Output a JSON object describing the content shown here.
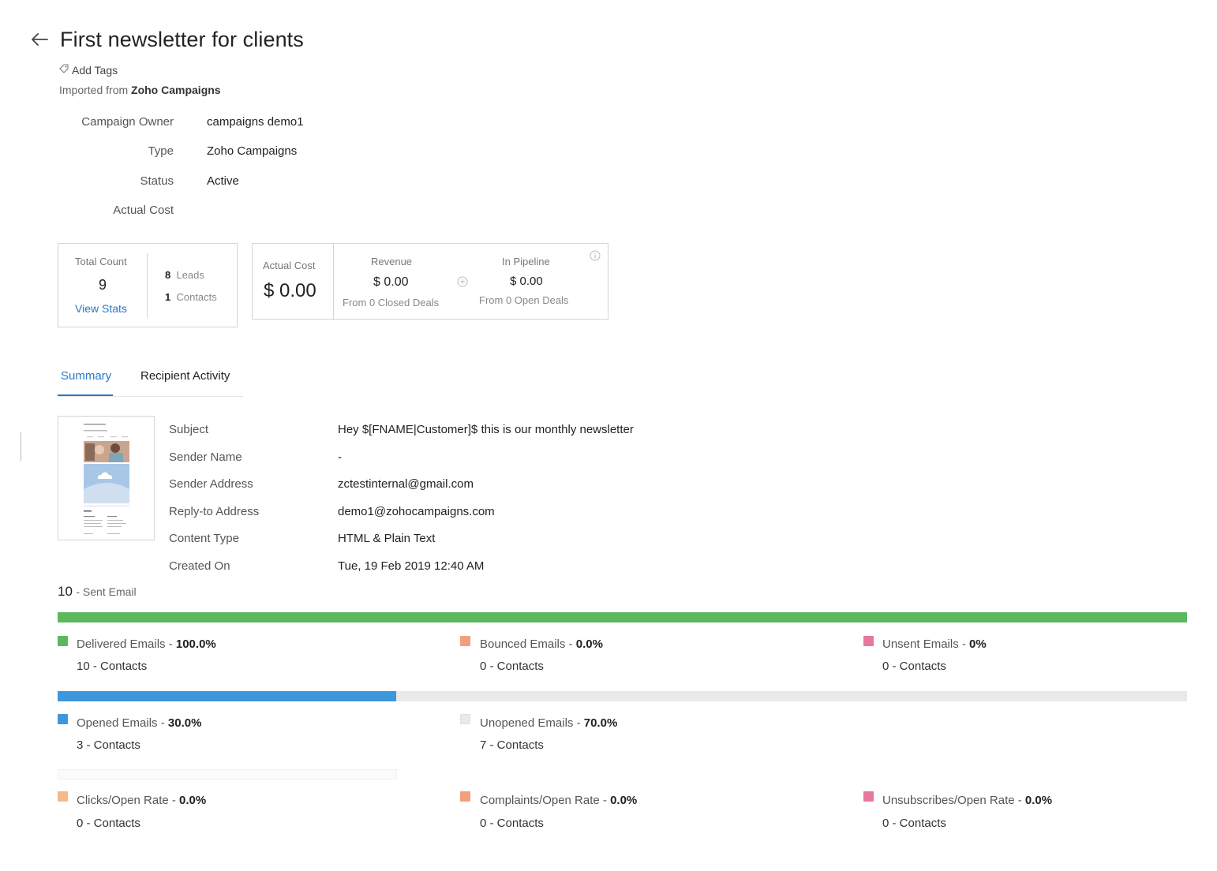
{
  "header": {
    "title": "First newsletter for clients",
    "add_tags": "Add Tags",
    "imported_prefix": "Imported from",
    "imported_source": "Zoho Campaigns"
  },
  "fields": {
    "owner_label": "Campaign Owner",
    "owner_value": "campaigns demo1",
    "type_label": "Type",
    "type_value": "Zoho Campaigns",
    "status_label": "Status",
    "status_value": "Active",
    "cost_label": "Actual Cost",
    "cost_value": ""
  },
  "stats": {
    "total_count_label": "Total Count",
    "total_count_value": "9",
    "view_stats": "View Stats",
    "leads_count": "8",
    "leads_label": "Leads",
    "contacts_count": "1",
    "contacts_label": "Contacts",
    "actual_cost_label": "Actual Cost",
    "actual_cost_value": "$ 0.00",
    "revenue_label": "Revenue",
    "revenue_value": "$ 0.00",
    "revenue_sub": "From 0 Closed Deals",
    "pipeline_label": "In Pipeline",
    "pipeline_value": "$ 0.00",
    "pipeline_sub": "From 0 Open Deals"
  },
  "tabs": [
    {
      "label": "Summary",
      "active": true
    },
    {
      "label": "Recipient Activity",
      "active": false
    }
  ],
  "summary": {
    "subject_label": "Subject",
    "subject_value": "Hey $[FNAME|Customer]$ this is our monthly newsletter",
    "sender_name_label": "Sender Name",
    "sender_name_value": "-",
    "sender_address_label": "Sender Address",
    "sender_address_value": "zctestinternal@gmail.com",
    "reply_to_label": "Reply-to Address",
    "reply_to_value": "demo1@zohocampaigns.com",
    "content_type_label": "Content Type",
    "content_type_value": "HTML & Plain Text",
    "created_on_label": "Created On",
    "created_on_value": "Tue, 19 Feb 2019 12:40 AM"
  },
  "sent": {
    "count": "10",
    "label": "- Sent Email"
  },
  "delivery": {
    "bar_fill": 1.0,
    "items": [
      {
        "label": "Delivered Emails -",
        "pct": "100.0%",
        "count": "10",
        "count_label": "- Contacts",
        "color": "#5cb85c"
      },
      {
        "label": "Bounced Emails -",
        "pct": "0.0%",
        "count": "0",
        "count_label": "- Contacts",
        "color": "#f2a07b"
      },
      {
        "label": "Unsent Emails -",
        "pct": "0%",
        "count": "0",
        "count_label": "- Contacts",
        "color": "#e8789a"
      }
    ]
  },
  "opens": {
    "bar_fill": 0.3,
    "items": [
      {
        "label": "Opened Emails -",
        "pct": "30.0%",
        "count": "3",
        "count_label": "- Contacts",
        "color": "#3d97dc"
      },
      {
        "label": "Unopened Emails -",
        "pct": "70.0%",
        "count": "7",
        "count_label": "- Contacts",
        "color": "#e9e9e9"
      }
    ]
  },
  "rates": {
    "items": [
      {
        "label": "Clicks/Open Rate -",
        "pct": "0.0%",
        "count": "0",
        "count_label": "- Contacts",
        "color": "#f5b98a"
      },
      {
        "label": "Complaints/Open Rate -",
        "pct": "0.0%",
        "count": "0",
        "count_label": "- Contacts",
        "color": "#f2a07b"
      },
      {
        "label": "Unsubscribes/Open Rate -",
        "pct": "0.0%",
        "count": "0",
        "count_label": "- Contacts",
        "color": "#e8789a"
      }
    ]
  }
}
